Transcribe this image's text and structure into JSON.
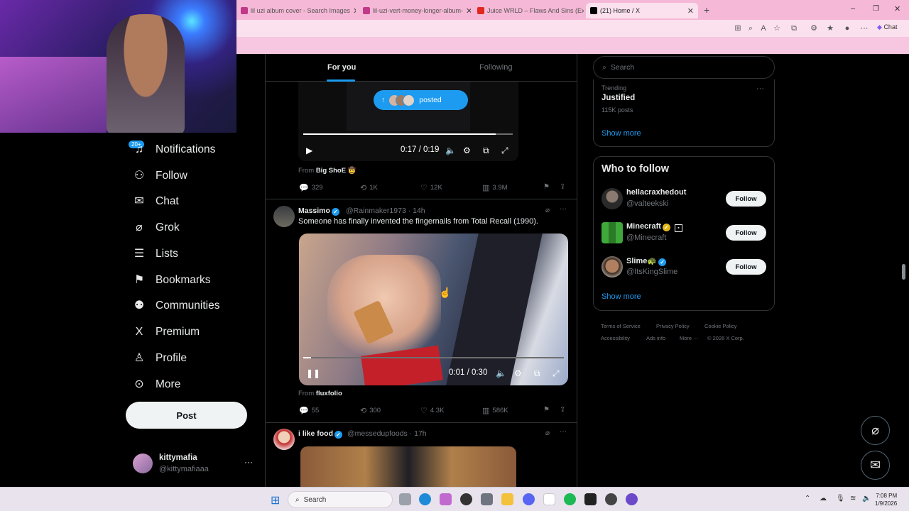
{
  "browser": {
    "tabs": [
      {
        "label": "lil uzi album cover - Search Images",
        "close": "✕",
        "color": "#c13a8a"
      },
      {
        "label": "lil-uzi-vert-money-longer-album-",
        "close": "✕",
        "color": "#c13a8a"
      },
      {
        "label": "Juice WRLD – Flaws And Sins (Exte",
        "close": "✕",
        "color": "#e0281e"
      },
      {
        "label": "(21) Home / X",
        "close": "✕",
        "color": "#000000"
      }
    ],
    "new_tab": "+",
    "window_controls": [
      "–",
      "❐",
      "✕"
    ],
    "chat_label": "Chat"
  },
  "sidebar": {
    "badge": "20+",
    "items": [
      {
        "label": "Notifications",
        "icon": "bell-icon",
        "glyph": "🔔"
      },
      {
        "label": "Follow",
        "icon": "follow-icon",
        "glyph": "👤"
      },
      {
        "label": "Chat",
        "icon": "mail-icon",
        "glyph": "✉"
      },
      {
        "label": "Grok",
        "icon": "grok-icon",
        "glyph": "⌀"
      },
      {
        "label": "Lists",
        "icon": "lists-icon",
        "glyph": "☰"
      },
      {
        "label": "Bookmarks",
        "icon": "bookmark-icon",
        "glyph": "🔖"
      },
      {
        "label": "Communities",
        "icon": "communities-icon",
        "glyph": "👥"
      },
      {
        "label": "Premium",
        "icon": "x-logo-icon",
        "glyph": "𝕏"
      },
      {
        "label": "Profile",
        "icon": "profile-icon",
        "glyph": "👤"
      },
      {
        "label": "More",
        "icon": "more-circle-icon",
        "glyph": "⋯"
      }
    ],
    "post_button": "Post",
    "account": {
      "name": "kittymafia",
      "handle": "@kittymafiaaa",
      "more": "···"
    }
  },
  "feed": {
    "tabs": {
      "for_you": "For you",
      "following": "Following"
    },
    "posted_pill": {
      "label": "posted",
      "arrow": "↑"
    },
    "post1": {
      "video": {
        "time": "0:17 / 0:19",
        "progress": 0.92
      },
      "from_prefix": "From",
      "from_name": "Big ShoE 🤠",
      "stats": {
        "replies": "329",
        "reposts": "1K",
        "likes": "12K",
        "views": "3.9M"
      }
    },
    "post2": {
      "name": "Massimo",
      "handle": "@Rainmaker1973",
      "time": "· 14h",
      "text": "Someone has finally invented the fingernails from Total Recall (1990).",
      "video": {
        "time": "0:01 / 0:30",
        "progress": 0.03
      },
      "from_prefix": "From",
      "from_name": "fluxfolio",
      "stats": {
        "replies": "55",
        "reposts": "300",
        "likes": "4.3K",
        "views": "586K"
      }
    },
    "post3": {
      "name": "i like food",
      "handle": "@messedupfoods",
      "time": "· 17h"
    }
  },
  "right": {
    "search_placeholder": "Search",
    "trending": {
      "label": "Trending",
      "title": "Justified",
      "posts": "115K posts",
      "more": "···"
    },
    "show_more": "Show more",
    "who_to_follow": "Who to follow",
    "suggestions": [
      {
        "name": "hellacraxhedout",
        "handle": "@valteekski",
        "follow": "Follow",
        "color": "#3a3a3a"
      },
      {
        "name": "Minecraft",
        "handle": "@Minecraft",
        "follow": "Follow",
        "color": "#3fa83a"
      },
      {
        "name": "Slime🐢",
        "handle": "@ItsKingSlime",
        "follow": "Follow",
        "color": "#b08060"
      }
    ],
    "footer": [
      "Terms of Service",
      "Privacy Policy",
      "Cookie Policy",
      "Accessibility",
      "Ads info",
      "More ···",
      "© 2026 X Corp."
    ]
  },
  "taskbar": {
    "search": "Search",
    "time": "7:08 PM",
    "date": "1/9/2026"
  }
}
